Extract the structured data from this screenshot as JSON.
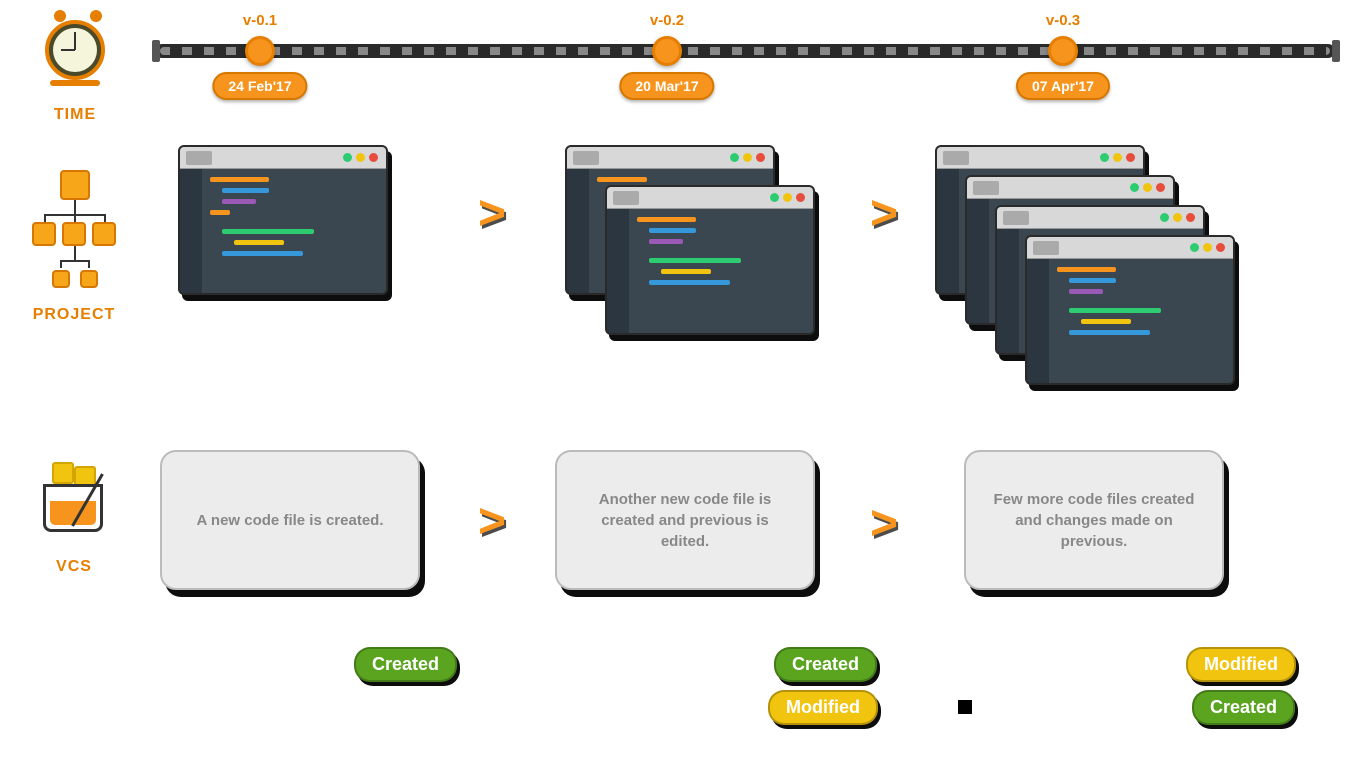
{
  "labels": {
    "time": "TIME",
    "project": "PROJECT",
    "vcs": "VCS"
  },
  "versions": [
    {
      "ver": "v-0.1",
      "date": "24 Feb'17"
    },
    {
      "ver": "v-0.2",
      "date": "20 Mar'17"
    },
    {
      "ver": "v-0.3",
      "date": "07 Apr'17"
    }
  ],
  "vcs_cards": [
    "A new code file is created.",
    "Another new code file is created and previous is edited.",
    "Few more code files created and changes made on previous."
  ],
  "badges": {
    "created": "Created",
    "modified": "Modified"
  }
}
